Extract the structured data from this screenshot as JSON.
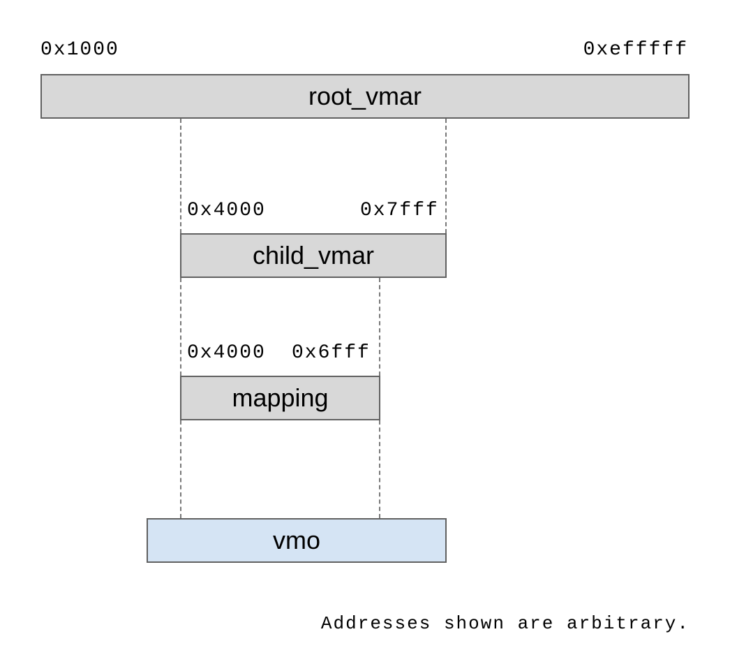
{
  "root_vmar": {
    "label": "root_vmar",
    "addr_start": "0x1000",
    "addr_end": "0xefffff"
  },
  "child_vmar": {
    "label": "child_vmar",
    "addr_start": "0x4000",
    "addr_end": "0x7fff"
  },
  "mapping": {
    "label": "mapping",
    "addr_start": "0x4000",
    "addr_end": "0x6fff"
  },
  "vmo": {
    "label": "vmo"
  },
  "footnote": "Addresses shown are arbitrary."
}
